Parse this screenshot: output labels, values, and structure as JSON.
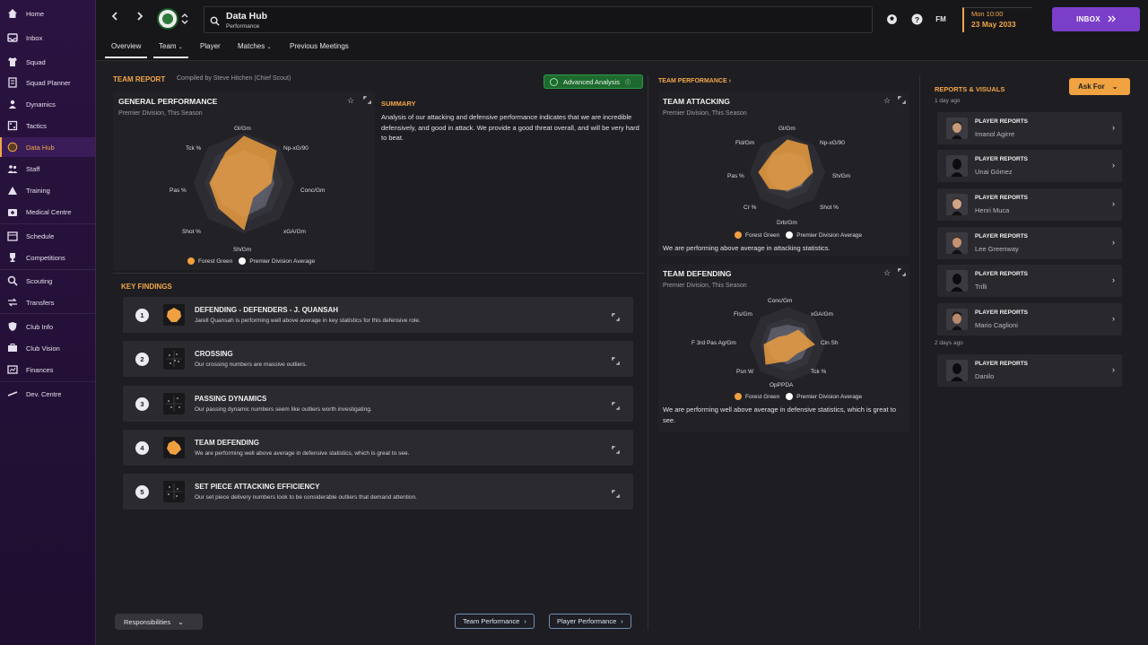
{
  "sidebar": {
    "items": [
      {
        "label": "Home",
        "icon": "home-icon"
      },
      {
        "label": "Inbox",
        "icon": "inbox-icon"
      },
      {
        "label": "Squad",
        "icon": "shirt-icon"
      },
      {
        "label": "Squad Planner",
        "icon": "planner-icon"
      },
      {
        "label": "Dynamics",
        "icon": "dynamics-icon"
      },
      {
        "label": "Tactics",
        "icon": "tactics-icon"
      },
      {
        "label": "Data Hub",
        "icon": "data-hub-icon",
        "active": true
      },
      {
        "label": "Staff",
        "icon": "staff-icon"
      },
      {
        "label": "Training",
        "icon": "training-icon"
      },
      {
        "label": "Medical Centre",
        "icon": "medical-icon"
      },
      {
        "label": "Schedule",
        "icon": "calendar-icon"
      },
      {
        "label": "Competitions",
        "icon": "trophy-icon"
      },
      {
        "label": "Scouting",
        "icon": "scouting-icon"
      },
      {
        "label": "Transfers",
        "icon": "transfers-icon"
      },
      {
        "label": "Club Info",
        "icon": "shield-icon"
      },
      {
        "label": "Club Vision",
        "icon": "vision-icon"
      },
      {
        "label": "Finances",
        "icon": "finances-icon"
      },
      {
        "label": "Dev. Centre",
        "icon": "dev-centre-icon"
      }
    ]
  },
  "header": {
    "title": "Data Hub",
    "subtitle": "Performance",
    "fm_label": "FM",
    "time": "Mon 10:00",
    "date": "23 May 2033",
    "inbox_label": "INBOX"
  },
  "tabs": [
    "Overview",
    "Team",
    "Player",
    "Matches",
    "Previous Meetings"
  ],
  "team_report": {
    "heading": "TEAM REPORT",
    "compiled_by": "Compiled by Steve Hitchen (Chief Scout)",
    "advanced_label": "Advanced Analysis",
    "general": {
      "title": "GENERAL PERFORMANCE",
      "subtitle": "Premier Division, This Season",
      "axes": [
        "Gl/Gm",
        "Np-xG/90",
        "Conc/Gm",
        "xGA/Gm",
        "Sh/Gm",
        "Shot %",
        "Pas %",
        "Tck %"
      ]
    },
    "summary_heading": "SUMMARY",
    "summary_text": "Analysis of our attacking and defensive performance indicates that we are incredible defensively, and good in attack. We provide a good threat overall, and will be very hard to beat.",
    "legend": [
      "Forest Green",
      "Premier Division Average"
    ]
  },
  "key_findings": {
    "heading": "KEY FINDINGS",
    "items": [
      {
        "num": "1",
        "title": "DEFENDING - DEFENDERS - J. QUANSAH",
        "desc": "Jarell Quansah is performing well above average in key statistics for this defensive role."
      },
      {
        "num": "2",
        "title": "CROSSING",
        "desc": "Our crossing numbers are massive outliers."
      },
      {
        "num": "3",
        "title": "PASSING DYNAMICS",
        "desc": "Our passing dynamic numbers seem like outliers worth investigating."
      },
      {
        "num": "4",
        "title": "TEAM DEFENDING",
        "desc": "We are performing well above average in defensive statistics, which is great to see."
      },
      {
        "num": "5",
        "title": "SET PIECE ATTACKING EFFICIENCY",
        "desc": "Our set piece delivery numbers look to be considerable outliers that demand attention."
      }
    ]
  },
  "footer": {
    "responsibilities": "Responsibilities",
    "team_perf_btn": "Team Performance",
    "player_perf_btn": "Player Performance"
  },
  "team_performance": {
    "heading": "TEAM PERFORMANCE",
    "attacking": {
      "title": "TEAM ATTACKING",
      "subtitle": "Premier Division, This Season",
      "axes": [
        "Gl/Gm",
        "Np-xG/90",
        "Sh/Gm",
        "Shot %",
        "Drb/Gm",
        "Cr %",
        "Pas %",
        "Fld/Gm"
      ],
      "text": "We are performing above average in attacking statistics."
    },
    "defending": {
      "title": "TEAM DEFENDING",
      "subtitle": "Premier Division, This Season",
      "axes": [
        "Conc/Gm",
        "xGA/Gm",
        "Cln Sh",
        "Tck %",
        "OpPPDA",
        "Psn W",
        "F 3rd Pas Ag/Gm",
        "Fls/Gm"
      ],
      "text": "We are performing well above average in defensive statistics, which is great to see."
    }
  },
  "reports": {
    "heading": "REPORTS & VISUALS",
    "ask_label": "Ask For",
    "group1": "1 day ago",
    "group2": "2 days ago",
    "item_title": "PLAYER REPORTS",
    "names": [
      "Imanol Agirre",
      "Unai Gómez",
      "Henri Muca",
      "Lee Greenway",
      "Trilli",
      "Mario Caglioni",
      "Danilo"
    ]
  },
  "colors": {
    "accent": "#f3a649",
    "team": "#f0a040",
    "average": "#ffffff",
    "inbox": "#7a3fc9"
  }
}
